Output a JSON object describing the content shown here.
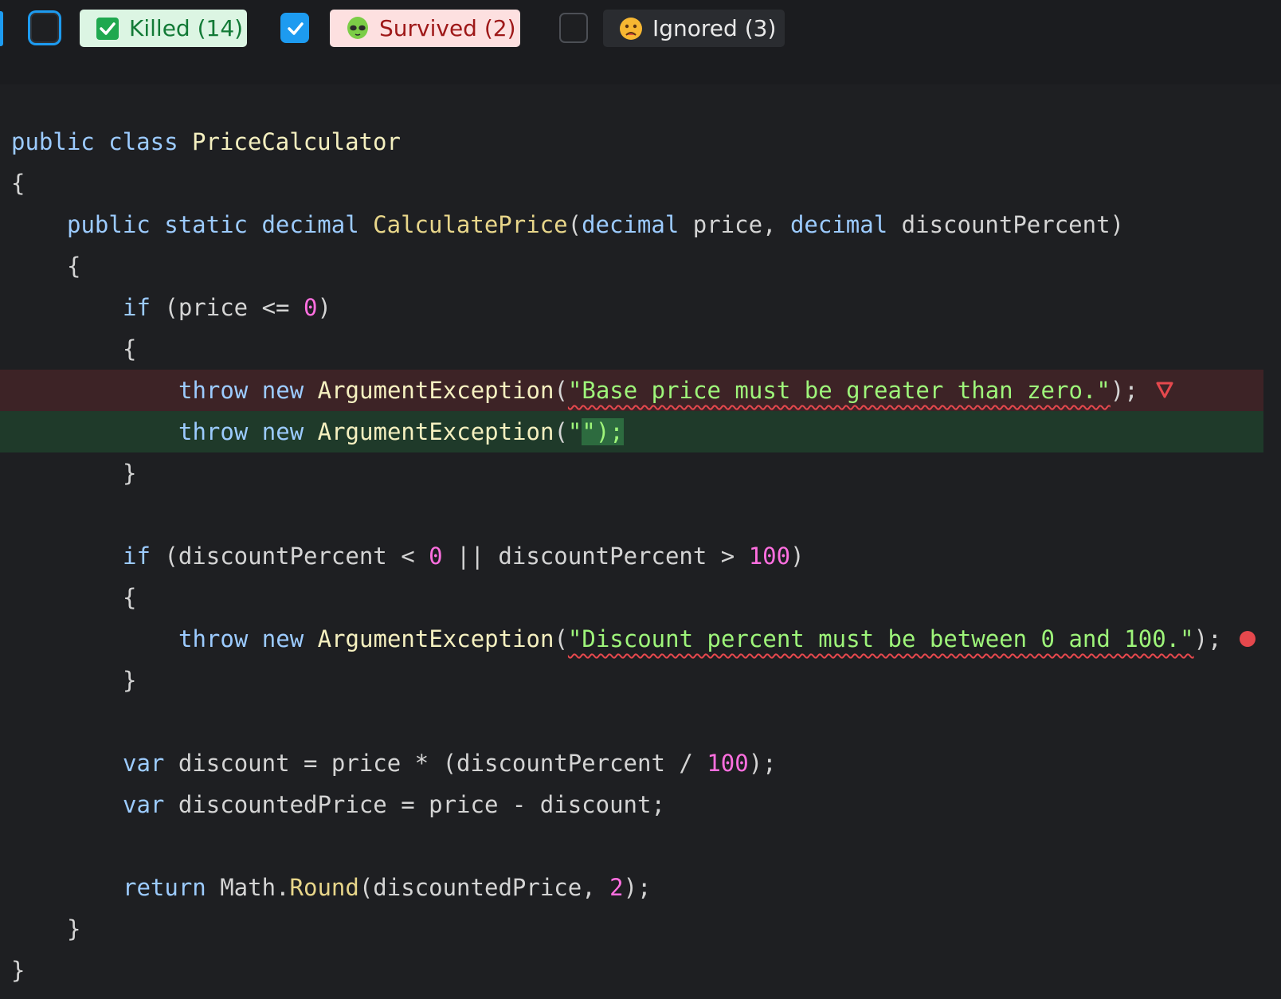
{
  "filters": {
    "killed": {
      "label": "Killed (14)",
      "checked": true,
      "icon": "check-icon"
    },
    "survived": {
      "label": "Survived (2)",
      "checked": true,
      "icon": "alien-icon"
    },
    "ignored": {
      "label": "Ignored (3)",
      "checked": false,
      "icon": "frowning-face-icon"
    }
  },
  "colors": {
    "accent": "#1d9bf0",
    "killed_bg": "#dcf5e3",
    "survived_bg": "#fde0e0",
    "removed_line": "#3d2326",
    "added_line": "#1f3a2a",
    "squiggle": "#e5484d"
  },
  "code": {
    "l1": {
      "kw1": "public",
      "kw2": "class",
      "name": "PriceCalculator"
    },
    "brace_open": "{",
    "brace_close": "}",
    "l3": {
      "kw1": "public",
      "kw2": "static",
      "kw3": "decimal",
      "fn": "CalculatePrice",
      "open": "(",
      "t1": "decimal",
      "p1": " price, ",
      "t2": "decimal",
      "p2": " discountPercent)"
    },
    "l5": {
      "kw": "if",
      "pre": " (price <= ",
      "num": "0",
      "post": ")"
    },
    "throw_kw": "throw",
    "new_kw": "new",
    "exc": "ArgumentException",
    "open_paren": "(",
    "close_stmt": ");",
    "l7": {
      "str": "\"Base price must be greater than zero.\""
    },
    "l8": {
      "quote": "\"",
      "post": "\");"
    },
    "l11": {
      "kw": "if",
      "pre": " (discountPercent < ",
      "num1": "0",
      "mid": " || discountPercent > ",
      "num2": "100",
      "post": ")"
    },
    "l13": {
      "str": "\"Discount percent must be between 0 and 100.\""
    },
    "l16": {
      "kw": "var",
      "pre": " discount = price * (discountPercent / ",
      "num": "100",
      "post": ");"
    },
    "l17": {
      "kw": "var",
      "rest": " discountedPrice = price - discount;"
    },
    "l19": {
      "kw": "return",
      "pre": " Math.",
      "fn": "Round",
      "mid": "(discountedPrice, ",
      "num": "2",
      "post": ");"
    }
  },
  "markers": {
    "survived_icon": "survived-mutant-triangle-icon",
    "killed_icon": "killed-mutant-dot-icon"
  }
}
